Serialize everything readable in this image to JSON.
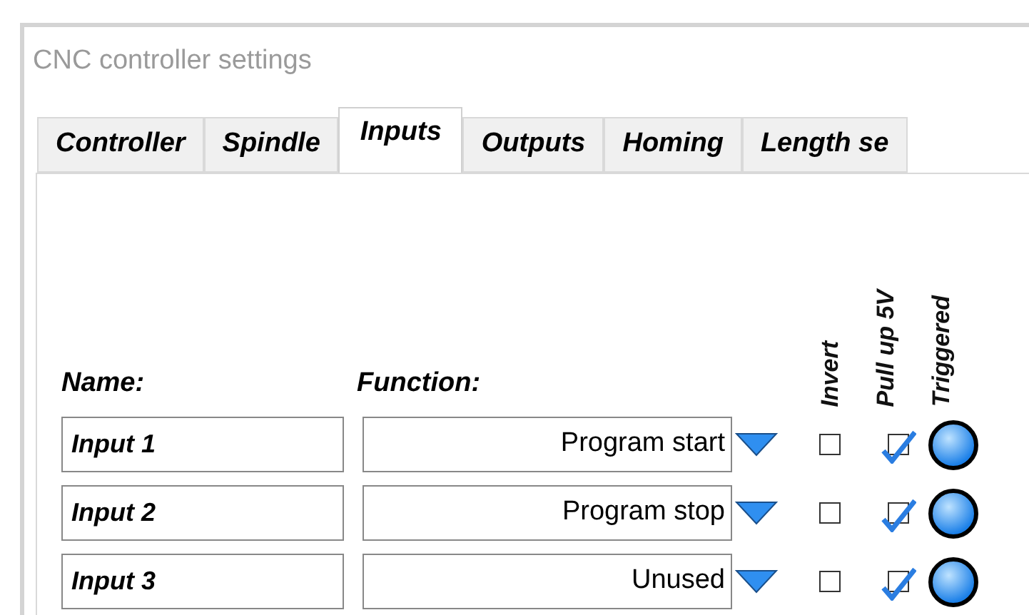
{
  "window": {
    "title": "CNC controller settings"
  },
  "tabs": [
    {
      "label": "Controller",
      "selected": false
    },
    {
      "label": "Spindle",
      "selected": false
    },
    {
      "label": "Inputs",
      "selected": true
    },
    {
      "label": "Outputs",
      "selected": false
    },
    {
      "label": "Homing",
      "selected": false
    },
    {
      "label": "Length se",
      "selected": false
    }
  ],
  "columns": {
    "name": "Name:",
    "function": "Function:",
    "invert": "Invert",
    "pull_up": "Pull up 5V",
    "triggered": "Triggered"
  },
  "inputs": [
    {
      "name": "Input 1",
      "function": "Program start",
      "invert": false,
      "pull_up": true,
      "triggered": true
    },
    {
      "name": "Input 2",
      "function": "Program stop",
      "invert": false,
      "pull_up": true,
      "triggered": true
    },
    {
      "name": "Input 3",
      "function": "Unused",
      "invert": false,
      "pull_up": true,
      "triggered": true
    }
  ]
}
